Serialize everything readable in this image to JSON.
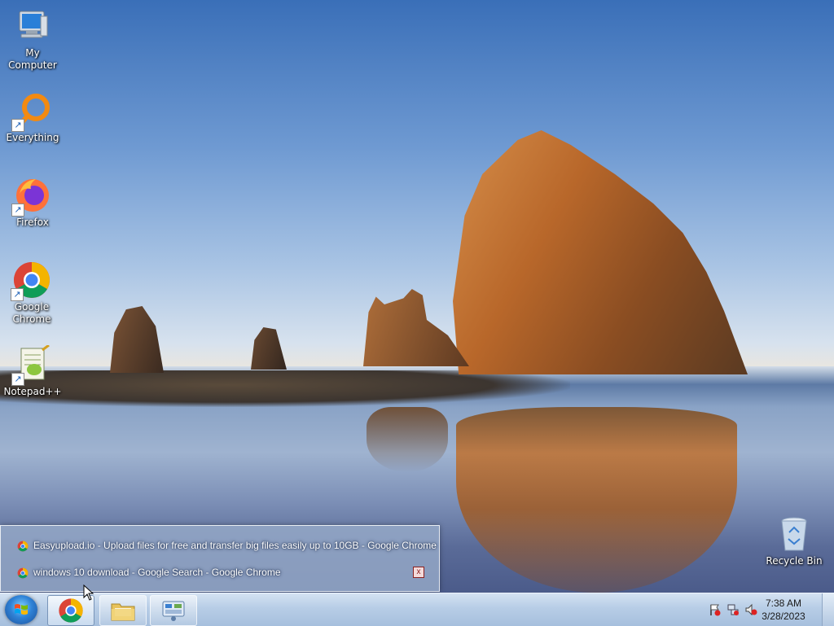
{
  "desktop": {
    "icons": [
      {
        "label": "My Computer",
        "icon": "computer-icon"
      },
      {
        "label": "Everything",
        "icon": "everything-icon"
      },
      {
        "label": "Firefox",
        "icon": "firefox-icon"
      },
      {
        "label": "Google Chrome",
        "icon": "chrome-icon"
      },
      {
        "label": "Notepad++",
        "icon": "notepadpp-icon"
      },
      {
        "label": "Recycle Bin",
        "icon": "recycle-bin-icon"
      }
    ]
  },
  "popup": {
    "items": [
      {
        "label": "Easyupload.io - Upload files for free and transfer big files easily up to 10GB - Google Chrome"
      },
      {
        "label": "windows 10 download - Google Search - Google Chrome"
      }
    ],
    "close_label": "x"
  },
  "taskbar": {
    "buttons": [
      {
        "name": "chrome",
        "icon": "chrome-icon"
      },
      {
        "name": "explorer",
        "icon": "folder-icon"
      },
      {
        "name": "control-panel",
        "icon": "control-panel-icon"
      }
    ],
    "clock": {
      "time": "7:38 AM",
      "date": "3/28/2023"
    }
  },
  "colors": {
    "taskbar": "#b7cde6",
    "accent": "#2f82d6"
  }
}
